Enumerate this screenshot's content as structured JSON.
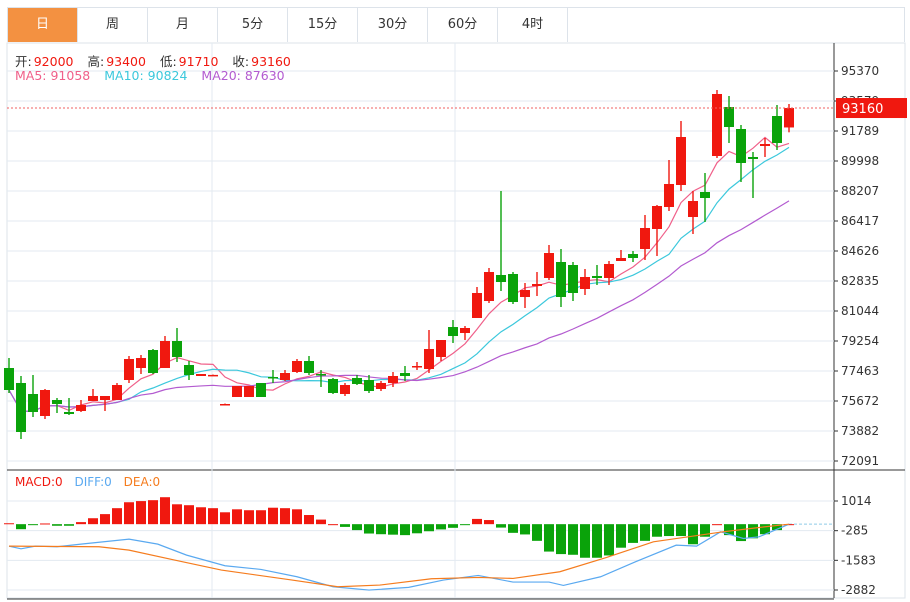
{
  "tabs": [
    {
      "label": "日",
      "active": true
    },
    {
      "label": "周",
      "active": false
    },
    {
      "label": "月",
      "active": false
    },
    {
      "label": "5分",
      "active": false
    },
    {
      "label": "15分",
      "active": false
    },
    {
      "label": "30分",
      "active": false
    },
    {
      "label": "60分",
      "active": false
    },
    {
      "label": "4时",
      "active": false
    }
  ],
  "ohlc_info": {
    "open_label": "开:",
    "open": "92000",
    "high_label": "高:",
    "high": "93400",
    "low_label": "低:",
    "low": "91710",
    "close_label": "收:",
    "close": "93160"
  },
  "ma_info": {
    "ma5": "MA5: 91058",
    "ma10": "MA10: 90824",
    "ma20": "MA20: 87630"
  },
  "macd_info": {
    "macd": "MACD:0",
    "diff": "DIFF:0",
    "dea": "DEA:0"
  },
  "last_price_tag": "93160",
  "colors": {
    "up": "#f0180f",
    "down": "#0aa30a",
    "active_tab": "#f39141",
    "ma5": "#f0608a",
    "ma10": "#3cc8dc",
    "ma20": "#b35bd0",
    "diff": "#5aa9f0",
    "dea": "#f57c1e"
  },
  "chart_data": [
    {
      "type": "candlestick",
      "y_ticks": [
        "95370",
        "93579",
        "91789",
        "89998",
        "88207",
        "86417",
        "84626",
        "82835",
        "81044",
        "79254",
        "77463",
        "75672",
        "73882",
        "72091"
      ],
      "ylim": [
        72091,
        95370
      ],
      "grid": true,
      "last_price": 93160,
      "ohlc": [
        [
          77642,
          78239,
          76150,
          76329
        ],
        [
          76747,
          77165,
          73404,
          73822
        ],
        [
          76090,
          77224,
          74717,
          75016
        ],
        [
          74777,
          76389,
          74598,
          76329
        ],
        [
          75732,
          75851,
          74956,
          75493
        ],
        [
          75016,
          75851,
          74837,
          74896
        ],
        [
          75075,
          75732,
          75016,
          75434
        ],
        [
          75672,
          76389,
          75672,
          75971
        ],
        [
          75732,
          75971,
          75075,
          75971
        ],
        [
          75732,
          76747,
          75732,
          76627
        ],
        [
          76926,
          78358,
          76747,
          78179
        ],
        [
          77642,
          78418,
          77284,
          78239
        ],
        [
          78716,
          78776,
          77284,
          77344
        ],
        [
          77642,
          79552,
          77642,
          79254
        ],
        [
          79254,
          80030,
          78000,
          78299
        ],
        [
          77821,
          78060,
          76926,
          77224
        ],
        [
          77165,
          77284,
          77165,
          77284
        ],
        [
          77200,
          77250,
          77180,
          77230
        ],
        [
          75493,
          75520,
          75460,
          75493
        ],
        [
          75911,
          76568,
          75911,
          76568
        ],
        [
          75911,
          76568,
          75911,
          76568
        ],
        [
          76747,
          76747,
          75911,
          75911
        ],
        [
          77105,
          77523,
          76747,
          77080
        ],
        [
          76926,
          77523,
          76866,
          77344
        ],
        [
          77403,
          78179,
          77344,
          78060
        ],
        [
          78060,
          78358,
          77224,
          77344
        ],
        [
          77284,
          77523,
          76508,
          77224
        ],
        [
          76985,
          77045,
          76090,
          76150
        ],
        [
          76090,
          76747,
          75971,
          76627
        ],
        [
          77045,
          77224,
          76627,
          76687
        ],
        [
          76926,
          77224,
          76150,
          76269
        ],
        [
          76389,
          76866,
          76269,
          76747
        ],
        [
          76747,
          77403,
          76508,
          77165
        ],
        [
          77344,
          77761,
          76866,
          77165
        ],
        [
          77740,
          78000,
          77523,
          77761
        ],
        [
          77582,
          79910,
          77344,
          78776
        ],
        [
          78299,
          79313,
          78060,
          79313
        ],
        [
          80089,
          80507,
          79134,
          79552
        ],
        [
          79731,
          80149,
          79313,
          80030
        ],
        [
          80627,
          82477,
          80627,
          82119
        ],
        [
          81641,
          83611,
          81522,
          83372
        ],
        [
          83193,
          88207,
          82238,
          82775
        ],
        [
          83253,
          83372,
          81462,
          81582
        ],
        [
          81880,
          82716,
          81223,
          82298
        ],
        [
          82537,
          83372,
          81940,
          82656
        ],
        [
          83014,
          84984,
          82895,
          84506
        ],
        [
          83969,
          84745,
          81283,
          81880
        ],
        [
          83790,
          83969,
          81641,
          82119
        ],
        [
          82358,
          83551,
          81999,
          83074
        ],
        [
          83134,
          83790,
          82596,
          83014
        ],
        [
          83014,
          84029,
          82596,
          83850
        ],
        [
          84029,
          84685,
          84029,
          84208
        ],
        [
          84447,
          84626,
          83969,
          84208
        ],
        [
          84745,
          86775,
          84089,
          85999
        ],
        [
          85939,
          87372,
          84327,
          87312
        ],
        [
          87252,
          90058,
          87013,
          88625
        ],
        [
          88565,
          92386,
          88207,
          91430
        ],
        [
          86655,
          88207,
          85641,
          87610
        ],
        [
          88148,
          89282,
          86357,
          87789
        ],
        [
          90296,
          94236,
          90177,
          93997
        ],
        [
          93221,
          93878,
          91072,
          92027
        ],
        [
          91908,
          92147,
          88744,
          89879
        ],
        [
          90237,
          90535,
          87789,
          90117
        ],
        [
          90893,
          91371,
          90237,
          91013
        ],
        [
          92684,
          93341,
          90654,
          91072
        ],
        [
          92000,
          93400,
          91710,
          93160
        ]
      ],
      "ohlc_order": [
        "open",
        "high",
        "low",
        "close"
      ],
      "series": [
        {
          "name": "MA5"
        },
        {
          "name": "MA10"
        },
        {
          "name": "MA20"
        }
      ]
    },
    {
      "type": "bar+line",
      "y_ticks": [
        "1014",
        "-285",
        "-1583",
        "-2882"
      ],
      "ylim": [
        -2882,
        1014
      ],
      "macd_hist": [
        40,
        -220,
        -20,
        30,
        -70,
        -70,
        90,
        260,
        440,
        700,
        960,
        1010,
        1050,
        1180,
        870,
        830,
        740,
        700,
        520,
        650,
        610,
        610,
        720,
        700,
        650,
        400,
        200,
        0,
        -120,
        -260,
        -410,
        -440,
        -460,
        -480,
        -400,
        -310,
        -230,
        -160,
        -10,
        230,
        180,
        -150,
        -380,
        -450,
        -730,
        -1200,
        -1310,
        -1340,
        -1470,
        -1470,
        -1370,
        -1030,
        -820,
        -730,
        -550,
        -520,
        -520,
        -880,
        -550,
        0,
        -480,
        -740,
        -620,
        -440,
        -260,
        0
      ],
      "diff_points": [
        [
          0,
          -961
        ],
        [
          1,
          -1078
        ],
        [
          2.2,
          -961
        ],
        [
          4,
          -990
        ],
        [
          6,
          -874
        ],
        [
          10,
          -655
        ],
        [
          12.4,
          -874
        ],
        [
          14.8,
          -1355
        ],
        [
          18,
          -1821
        ],
        [
          21,
          -1981
        ],
        [
          24,
          -2302
        ],
        [
          27,
          -2739
        ],
        [
          30,
          -2885
        ],
        [
          33.3,
          -2768
        ],
        [
          36.2,
          -2448
        ],
        [
          39.1,
          -2244
        ],
        [
          42,
          -2535
        ],
        [
          45,
          -2535
        ],
        [
          46.2,
          -2681
        ],
        [
          49.3,
          -2302
        ],
        [
          52.2,
          -1646
        ],
        [
          55.6,
          -918
        ],
        [
          57.3,
          -961
        ],
        [
          59.3,
          -335
        ],
        [
          61.2,
          -627
        ],
        [
          62.5,
          -554
        ],
        [
          65,
          0
        ]
      ],
      "dea_points": [
        [
          0,
          -961
        ],
        [
          7.5,
          -990
        ],
        [
          10,
          -1136
        ],
        [
          13.8,
          -1573
        ],
        [
          17.7,
          -2010
        ],
        [
          23.6,
          -2448
        ],
        [
          27.4,
          -2739
        ],
        [
          30.9,
          -2666
        ],
        [
          35.2,
          -2389
        ],
        [
          39.1,
          -2331
        ],
        [
          42,
          -2375
        ],
        [
          45.9,
          -2083
        ],
        [
          49.8,
          -1457
        ],
        [
          53.7,
          -772
        ],
        [
          59.5,
          -335
        ],
        [
          62.5,
          -146
        ],
        [
          65,
          0
        ]
      ],
      "series": [
        {
          "name": "MACD"
        },
        {
          "name": "DIFF"
        },
        {
          "name": "DEA"
        }
      ]
    }
  ]
}
